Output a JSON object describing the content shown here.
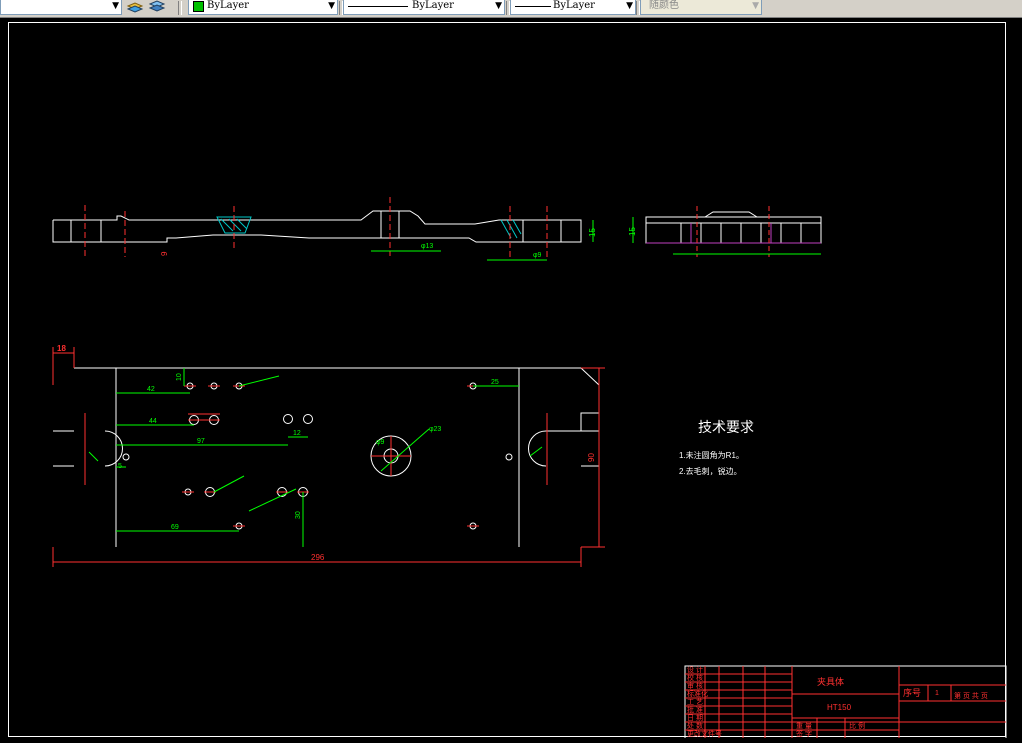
{
  "toolbar": {
    "color_value": "ByLayer",
    "linetype_value": "ByLayer",
    "lineweight_value": "ByLayer",
    "plotstyle_value": "随颜色",
    "dropdown_glyph": "▼",
    "icons": [
      "layer-states-icon",
      "layer-previous-icon"
    ],
    "accent_green": "#00c000"
  },
  "drawing": {
    "tech_title": "技术要求",
    "tech_note1": "1.未注圆角为R1。",
    "tech_note2": "2.去毛刺，锐边。",
    "dim_42": "42",
    "dim_44": "44",
    "dim_97": "97",
    "dim_69": "69",
    "dim_12": "12",
    "dim_25": "25",
    "dim_5": "5",
    "dim_10": "10",
    "dim_30": "30",
    "dim_90": "90",
    "dim_296": "296",
    "dim_18": "18",
    "dim_phi23": "φ23",
    "dim_phi9": "φ9",
    "dim_15": "15",
    "title_block": {
      "part_name": "夹具体",
      "material": "HT150",
      "seq_label": "序号",
      "seq_value": "1",
      "sheet_label": "第 页 共 页",
      "row_labels": [
        "设 计",
        "校 核",
        "审 核",
        "标准化",
        "工 艺",
        "批 准",
        "日 期",
        "处 数",
        "更改文件号",
        "签 字"
      ],
      "bottom_labels": [
        "重 量",
        "比 例"
      ]
    }
  }
}
